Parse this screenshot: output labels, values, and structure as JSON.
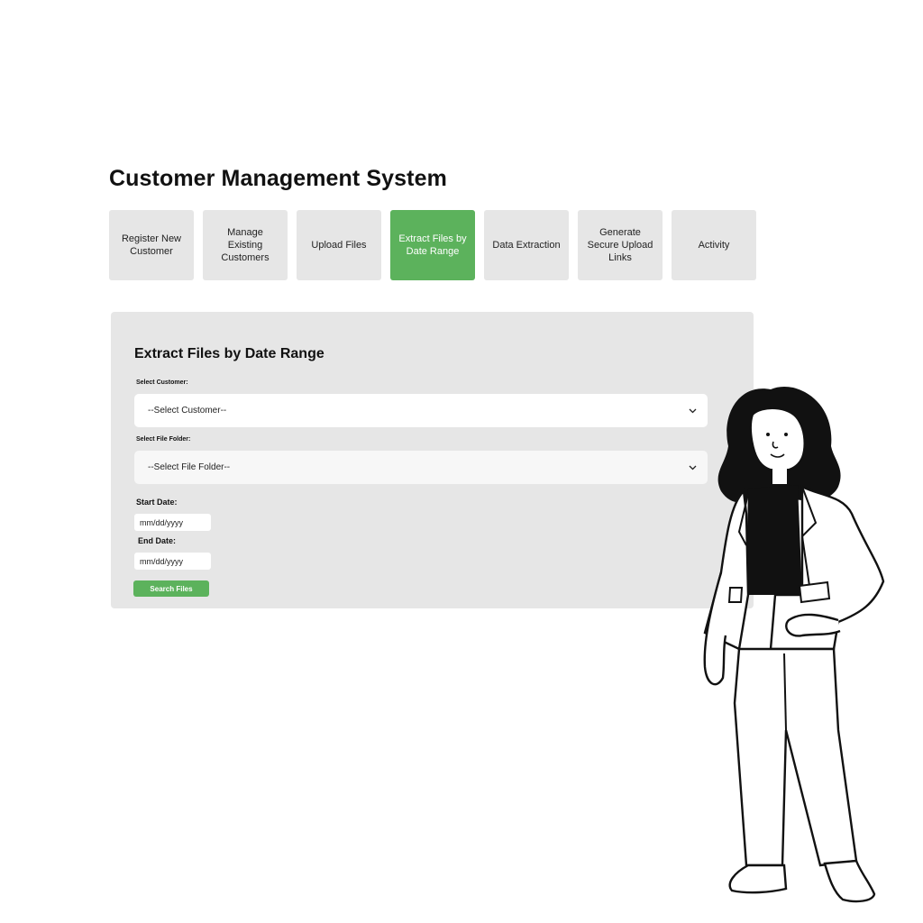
{
  "app": {
    "title": "Customer Management System"
  },
  "nav": {
    "tabs": [
      {
        "label": "Register New Customer"
      },
      {
        "label": "Manage Existing Customers"
      },
      {
        "label": "Upload Files"
      },
      {
        "label": "Extract Files by Date Range",
        "active": true
      },
      {
        "label": "Data Extraction"
      },
      {
        "label": "Generate Secure Upload Links"
      },
      {
        "label": "Activity"
      }
    ]
  },
  "form": {
    "title": "Extract Files by Date Range",
    "customer_label": "Select Customer:",
    "customer_value": "--Select Customer--",
    "folder_label": "Select File Folder:",
    "folder_value": "--Select File Folder--",
    "start_label": "Start Date:",
    "start_placeholder": "mm/dd/yyyy",
    "end_label": "End Date:",
    "end_placeholder": "mm/dd/yyyy",
    "search_label": "Search Files"
  },
  "icons": {
    "dropdown": "chevron-down-icon",
    "illustration": "woman-standing-illustration"
  },
  "colors": {
    "accent": "#5cb25c",
    "tab_bg": "#e6e6e6",
    "panel_bg": "#e6e6e6"
  }
}
